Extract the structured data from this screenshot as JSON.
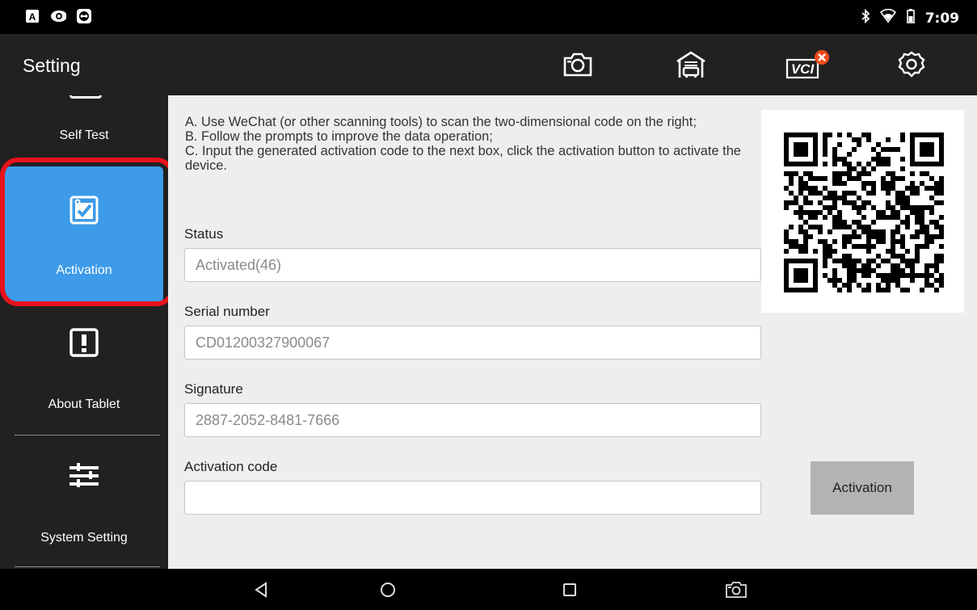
{
  "status_bar": {
    "time": "7:09",
    "left_icons": [
      "a-notification-icon",
      "eye-icon",
      "teamviewer-icon"
    ],
    "right_icons": [
      "bluetooth-icon",
      "wifi-icon",
      "battery-icon"
    ]
  },
  "app_bar": {
    "title": "Setting",
    "actions": [
      "screenshot-camera-icon",
      "garage-icon",
      "vci-icon",
      "settings-gear-icon"
    ],
    "vci_label": "VCI",
    "vci_status_color": "#f04a1c"
  },
  "sidebar": {
    "items": [
      {
        "label": "Self Test",
        "icon": "self-test-icon"
      },
      {
        "label": "Activation",
        "icon": "activation-check-icon",
        "active": true
      },
      {
        "label": "About Tablet",
        "icon": "exclamation-icon"
      },
      {
        "label": "System Setting",
        "icon": "sliders-icon"
      }
    ],
    "active_color": "#3d9be9",
    "highlight_color": "#e8121b"
  },
  "main": {
    "instructions": "A. Use WeChat (or other scanning tools) to scan the two-dimensional code on the right;\nB. Follow the prompts to improve the data operation;\nC. Input the generated activation code to the next box, click the activation button to activate the device.",
    "fields": {
      "status": {
        "label": "Status",
        "value": "Activated(46)"
      },
      "serial": {
        "label": "Serial number",
        "value": "CD01200327900067"
      },
      "signature": {
        "label": "Signature",
        "value": "2887-2052-8481-7666"
      },
      "activation_code": {
        "label": "Activation code",
        "value": ""
      }
    },
    "activation_button": "Activation"
  },
  "nav_bar": {
    "buttons": [
      "back-icon",
      "home-icon",
      "recents-icon",
      "screenshot-icon"
    ]
  }
}
